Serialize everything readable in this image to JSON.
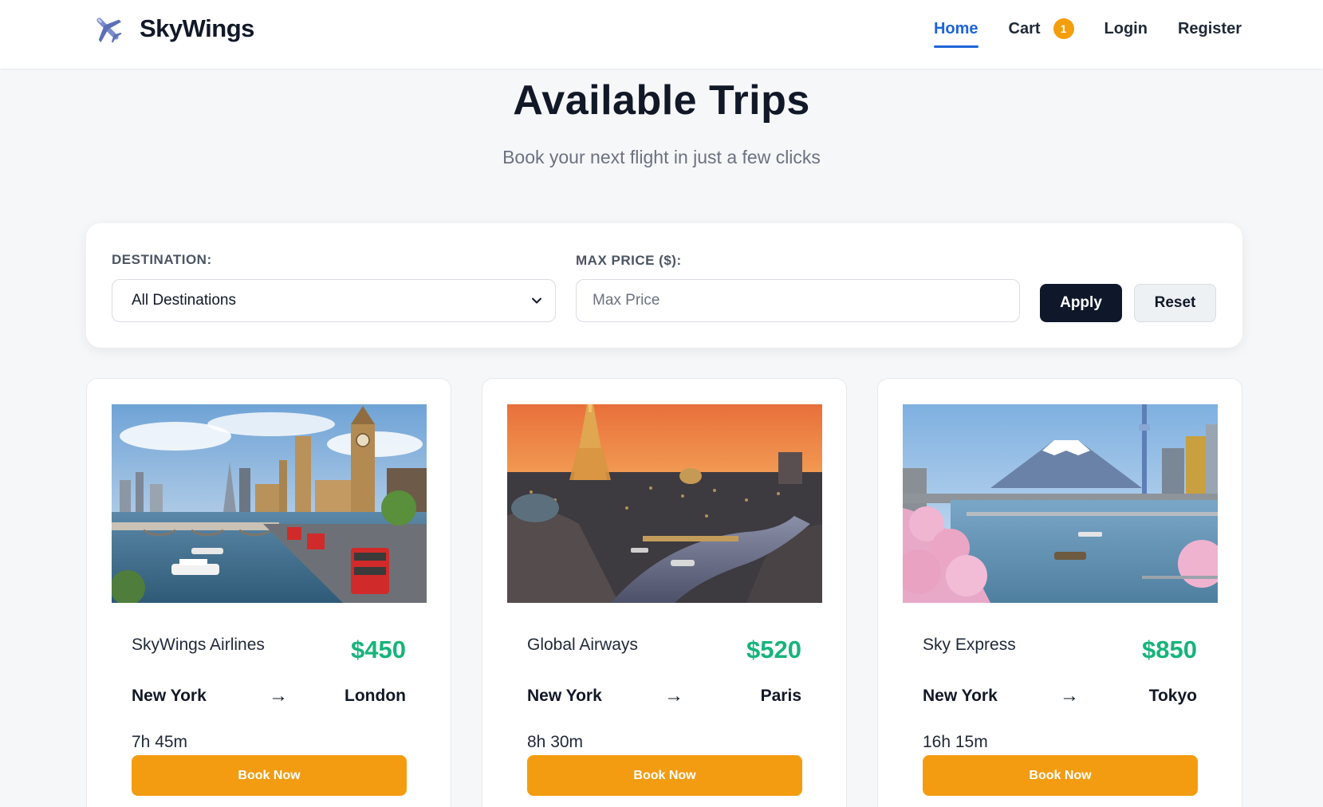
{
  "brand": {
    "name": "SkyWings",
    "logo_icon": "airplane-icon"
  },
  "nav": {
    "home": "Home",
    "cart": "Cart",
    "cart_count": "1",
    "login": "Login",
    "register": "Register"
  },
  "hero": {
    "title": "Available Trips",
    "subtitle": "Book your next flight in just a few clicks"
  },
  "filters": {
    "destination_label": "DESTINATION:",
    "destination_value": "All Destinations",
    "max_price_label": "MAX PRICE ($):",
    "max_price_placeholder": "Max Price",
    "max_price_value": "",
    "apply_label": "Apply",
    "reset_label": "Reset"
  },
  "trips": [
    {
      "airline": "SkyWings Airlines",
      "price": "$450",
      "from": "New York",
      "arrow": "→",
      "to": "London",
      "duration": "7h 45m",
      "book_label": "Book Now"
    },
    {
      "airline": "Global Airways",
      "price": "$520",
      "from": "New York",
      "arrow": "→",
      "to": "Paris",
      "duration": "8h 30m",
      "book_label": "Book Now"
    },
    {
      "airline": "Sky Express",
      "price": "$850",
      "from": "New York",
      "arrow": "→",
      "to": "Tokyo",
      "duration": "16h 15m",
      "book_label": "Book Now"
    }
  ],
  "colors": {
    "accent_blue": "#1d64d8",
    "price_green": "#16b47a",
    "book_orange": "#f39c12",
    "badge_orange": "#f59e0b",
    "apply_dark": "#0f172a"
  }
}
